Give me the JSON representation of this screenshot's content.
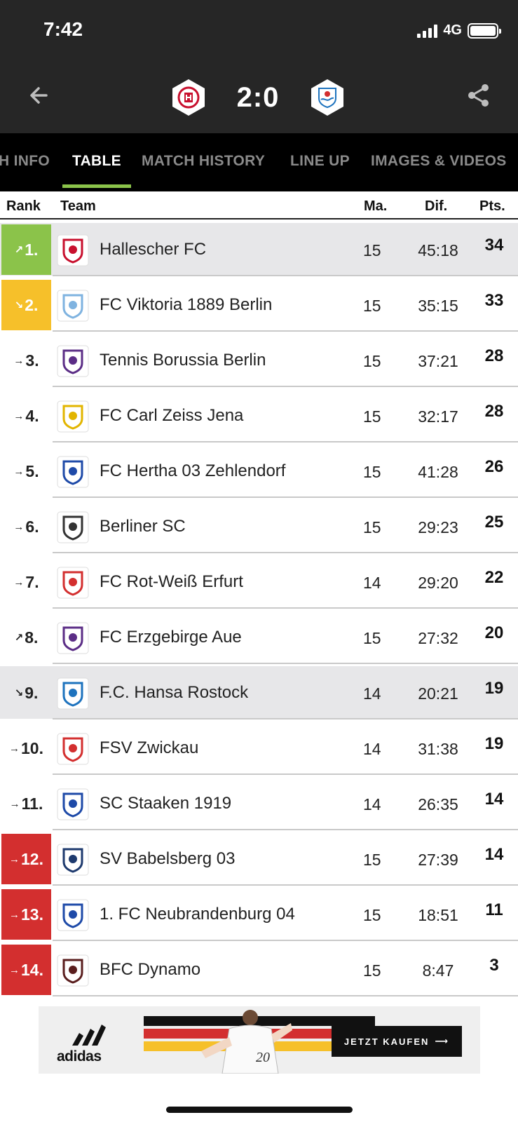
{
  "status_bar": {
    "time": "7:42",
    "network": "4G"
  },
  "match": {
    "score": "2:0",
    "home_crest": "hallescher-fc-crest",
    "away_crest": "hansa-rostock-crest"
  },
  "tabs": [
    {
      "label": "H INFO"
    },
    {
      "label": "TABLE",
      "active": true
    },
    {
      "label": "MATCH HISTORY"
    },
    {
      "label": "LINE UP"
    },
    {
      "label": "IMAGES & VIDEOS"
    }
  ],
  "table_header": {
    "rank": "Rank",
    "team": "Team",
    "matches": "Ma.",
    "diff": "Dif.",
    "points": "Pts."
  },
  "rows": [
    {
      "rank": "1.",
      "trend": "up",
      "zone": "promotion",
      "team": "Hallescher FC",
      "ma": "15",
      "dif": "45:18",
      "pts": "34",
      "crest_color": "#c8102e",
      "highlighted": true
    },
    {
      "rank": "2.",
      "trend": "down",
      "zone": "playoff",
      "team": "FC Viktoria 1889 Berlin",
      "ma": "15",
      "dif": "35:15",
      "pts": "33",
      "crest_color": "#7fb3e0"
    },
    {
      "rank": "3.",
      "trend": "same",
      "zone": "none",
      "team": "Tennis Borussia Berlin",
      "ma": "15",
      "dif": "37:21",
      "pts": "28",
      "crest_color": "#5b2d86"
    },
    {
      "rank": "4.",
      "trend": "same",
      "zone": "none",
      "team": "FC Carl Zeiss Jena",
      "ma": "15",
      "dif": "32:17",
      "pts": "28",
      "crest_color": "#e2b500"
    },
    {
      "rank": "5.",
      "trend": "same",
      "zone": "none",
      "team": "FC Hertha 03 Zehlendorf",
      "ma": "15",
      "dif": "41:28",
      "pts": "26",
      "crest_color": "#1e4aa8"
    },
    {
      "rank": "6.",
      "trend": "same",
      "zone": "none",
      "team": "Berliner SC",
      "ma": "15",
      "dif": "29:23",
      "pts": "25",
      "crest_color": "#333333"
    },
    {
      "rank": "7.",
      "trend": "same",
      "zone": "none",
      "team": "FC Rot-Weiß Erfurt",
      "ma": "14",
      "dif": "29:20",
      "pts": "22",
      "crest_color": "#d32f2f"
    },
    {
      "rank": "8.",
      "trend": "up",
      "zone": "none",
      "team": "FC Erzgebirge Aue",
      "ma": "15",
      "dif": "27:32",
      "pts": "20",
      "crest_color": "#5b2d86"
    },
    {
      "rank": "9.",
      "trend": "down",
      "zone": "none",
      "team": "F.C. Hansa Rostock",
      "ma": "14",
      "dif": "20:21",
      "pts": "19",
      "crest_color": "#1e73be",
      "highlighted": true
    },
    {
      "rank": "10.",
      "trend": "same",
      "zone": "none",
      "team": "FSV Zwickau",
      "ma": "14",
      "dif": "31:38",
      "pts": "19",
      "crest_color": "#d32f2f"
    },
    {
      "rank": "11.",
      "trend": "same",
      "zone": "none",
      "team": "SC Staaken 1919",
      "ma": "14",
      "dif": "26:35",
      "pts": "14",
      "crest_color": "#1e4aa8"
    },
    {
      "rank": "12.",
      "trend": "same",
      "zone": "relegation",
      "team": "SV Babelsberg 03",
      "ma": "15",
      "dif": "27:39",
      "pts": "14",
      "crest_color": "#1e3a6e"
    },
    {
      "rank": "13.",
      "trend": "same",
      "zone": "relegation",
      "team": "1. FC Neubrandenburg 04",
      "ma": "15",
      "dif": "18:51",
      "pts": "11",
      "crest_color": "#1e4aa8"
    },
    {
      "rank": "14.",
      "trend": "same",
      "zone": "relegation",
      "team": "BFC Dynamo",
      "ma": "15",
      "dif": "8:47",
      "pts": "3",
      "crest_color": "#5a1e1e"
    }
  ],
  "ad": {
    "brand": "adidas",
    "cta": "JETZT KAUFEN",
    "jersey_number": "20"
  },
  "colors": {
    "accent_green": "#8bc34a",
    "promotion_green": "#8bc34a",
    "playoff_yellow": "#f6c02a",
    "relegation_red": "#d32f2f"
  }
}
